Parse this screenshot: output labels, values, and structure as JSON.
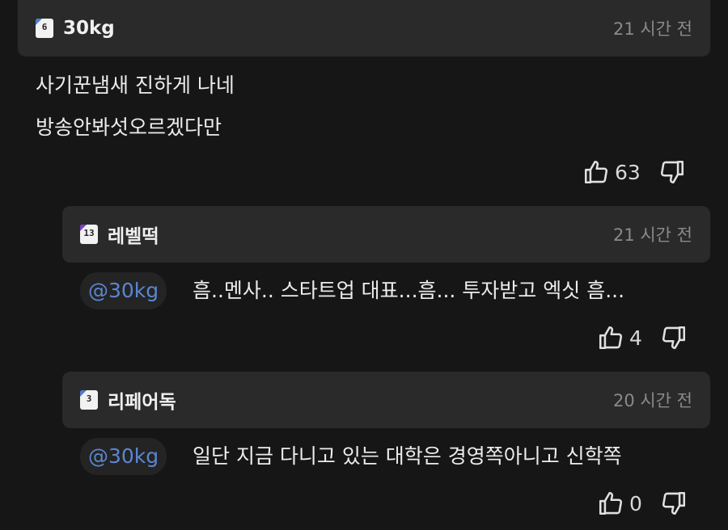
{
  "comments": [
    {
      "level": "6",
      "username": "30kg",
      "time": "21 시간 전",
      "lines": [
        "사기꾼냄새 진하게 나네",
        "방송안봐섯오르겠다만"
      ],
      "likes": "63"
    },
    {
      "level": "13",
      "username": "레벨떡",
      "time": "21 시간 전",
      "mention": "@30kg",
      "text": "흠..멘사.. 스타트업 대표...흠... 투자받고 엑싯 흠...",
      "likes": "4"
    },
    {
      "level": "3",
      "username": "리페어독",
      "time": "20 시간 전",
      "mention": "@30kg",
      "text": "일단 지금 다니고 있는 대학은 경영쪽아니고 신학쪽",
      "likes": "0"
    }
  ],
  "colors": {
    "level_corner": "#4a7fd0",
    "level_corner_alt": "#7a3fd0",
    "mention": "#5b86d0"
  }
}
